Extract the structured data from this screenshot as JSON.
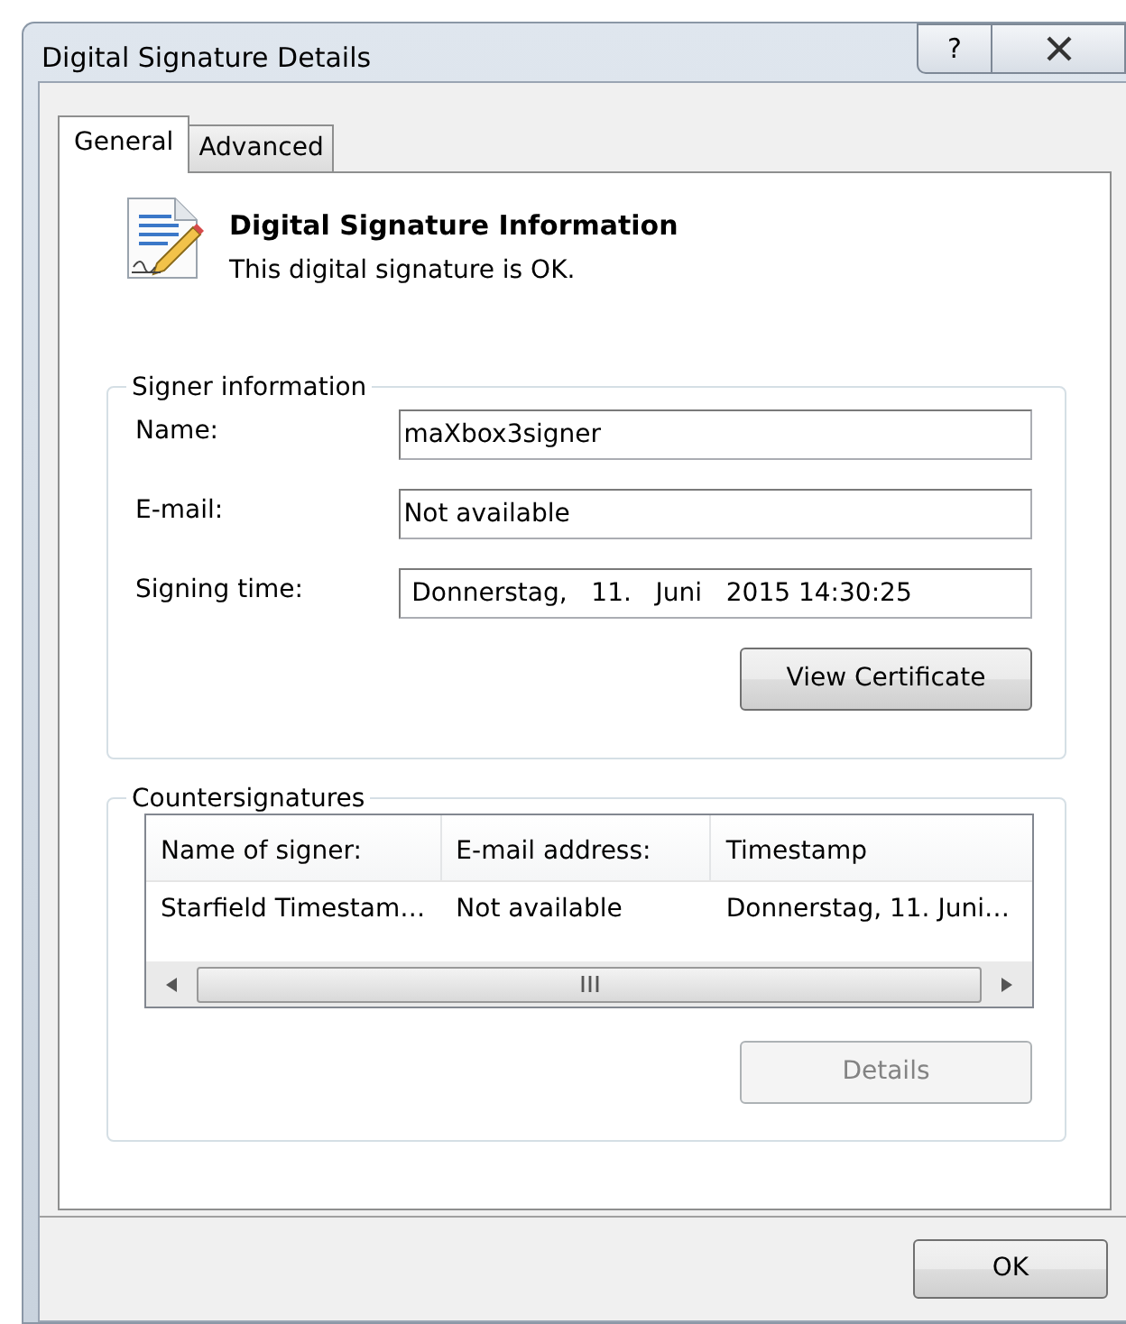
{
  "window": {
    "title": "Digital Signature Details",
    "help_button": "?"
  },
  "tabs": [
    {
      "label": "General",
      "selected": true
    },
    {
      "label": "Advanced",
      "selected": false
    }
  ],
  "header": {
    "title": "Digital Signature Information",
    "status": "This digital signature is OK."
  },
  "signer_information": {
    "legend": "Signer information",
    "fields": [
      {
        "label": "Name:",
        "value": "maXbox3signer"
      },
      {
        "label": "E-mail:",
        "value": "Not available"
      },
      {
        "label": "Signing time:",
        "value": " Donnerstag,   11.   Juni   2015 14:30:25"
      }
    ],
    "button": {
      "label": "View Certificate",
      "disabled": false
    }
  },
  "countersignatures": {
    "legend": "Countersignatures",
    "table": {
      "columns": [
        "Name of signer:",
        "E-mail address:",
        "Timestamp"
      ],
      "rows": [
        [
          "Starfield Timestam…",
          "Not available",
          "Donnerstag, 11. Juni…"
        ]
      ]
    },
    "button": {
      "label": "Details",
      "disabled": true
    }
  },
  "buttons": [
    {
      "label": "OK",
      "disabled": false
    }
  ]
}
